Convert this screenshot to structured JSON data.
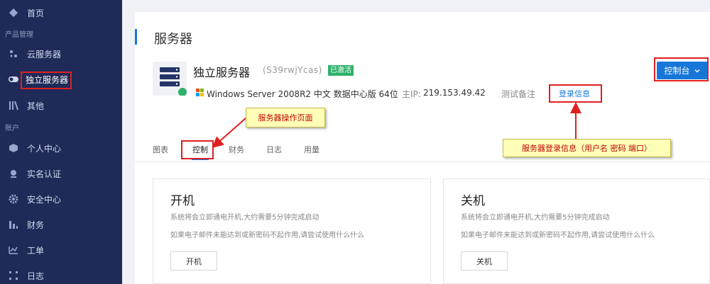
{
  "sidebar": {
    "items": [
      {
        "label": "首页",
        "icon": "diamond-icon"
      },
      {
        "label": "云服务器",
        "icon": "cloud-server-icon"
      },
      {
        "label": "独立服务器",
        "icon": "toggle-icon"
      },
      {
        "label": "其他",
        "icon": "bars-icon"
      },
      {
        "label": "个人中心",
        "icon": "cube-icon"
      },
      {
        "label": "实名认证",
        "icon": "badge-icon"
      },
      {
        "label": "安全中心",
        "icon": "gear-icon"
      },
      {
        "label": "财务",
        "icon": "chart-bars-icon"
      },
      {
        "label": "工单",
        "icon": "pulse-icon"
      },
      {
        "label": "日志",
        "icon": "grid-icon"
      }
    ],
    "sections": {
      "products": "产品管理",
      "account": "账户"
    }
  },
  "page": {
    "title": "服务器"
  },
  "server": {
    "name": "独立服务器",
    "id": "(S39rwjYcas)",
    "status": "已激活",
    "os": "Windows Server 2008R2 中文 数据中心版 64位",
    "ip_label": "主IP:",
    "ip": "219.153.49.42",
    "remark": "测试备注",
    "login_info": "登录信息",
    "console_label": "控制台"
  },
  "tabs": [
    "图表",
    "控制",
    "财务",
    "日志",
    "用量"
  ],
  "cards": [
    {
      "title": "开机",
      "line1": "系统将会立即通电开机,大约需要5分钟完成启动",
      "line2": "如果电子邮件未能达到或新密码不起作用,请尝试使用什么什么",
      "button": "开机"
    },
    {
      "title": "关机",
      "line1": "系统将会立即通电开机,大约需要5分钟完成启动",
      "line2": "如果电子邮件未能达到或新密码不起作用,请尝试使用什么什么",
      "button": "关机"
    }
  ],
  "annotations": {
    "page_callout": "服务器操作页面",
    "login_callout": "服务器登录信息（用户名 密码  端口）"
  },
  "colors": {
    "accent": "#1677d8",
    "sidebar": "#1f2a58",
    "success": "#2db16a",
    "annotation": "#e02020"
  }
}
